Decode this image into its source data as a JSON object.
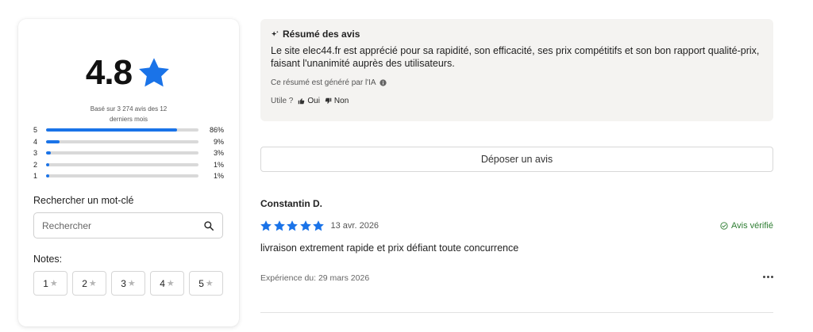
{
  "rating": {
    "score": "4.8",
    "based_on_line1": "Basé sur 3 274 avis des 12",
    "based_on_line2": "derniers mois",
    "distribution": [
      {
        "label": "5",
        "pct_text": "86%",
        "pct": 86
      },
      {
        "label": "4",
        "pct_text": "9%",
        "pct": 9
      },
      {
        "label": "3",
        "pct_text": "3%",
        "pct": 3
      },
      {
        "label": "2",
        "pct_text": "1%",
        "pct": 1
      },
      {
        "label": "1",
        "pct_text": "1%",
        "pct": 1
      }
    ],
    "accent_color": "#1a73e8"
  },
  "search": {
    "title": "Rechercher un mot-clé",
    "placeholder": "Rechercher",
    "icon": "search-icon"
  },
  "notes": {
    "title": "Notes:",
    "items": [
      "1",
      "2",
      "3",
      "4",
      "5"
    ]
  },
  "summary": {
    "title": "Résumé des avis",
    "text": "Le site elec44.fr est apprécié pour sa rapidité, son efficacité, ses prix compétitifs et son bon rapport qualité-prix, faisant l'unanimité auprès des utilisateurs.",
    "ai_note": "Ce résumé est généré par l'IA",
    "useful_label": "Utile ?",
    "yes_label": "Oui",
    "no_label": "Non"
  },
  "deposit_label": "Déposer un avis",
  "review": {
    "author": "Constantin D.",
    "stars": 5,
    "date": "13 avr. 2026",
    "verified": "Avis vérifié",
    "text": "livraison extrement rapide et prix défiant toute concurrence",
    "experience": "Expérience du: 29 mars 2026"
  }
}
